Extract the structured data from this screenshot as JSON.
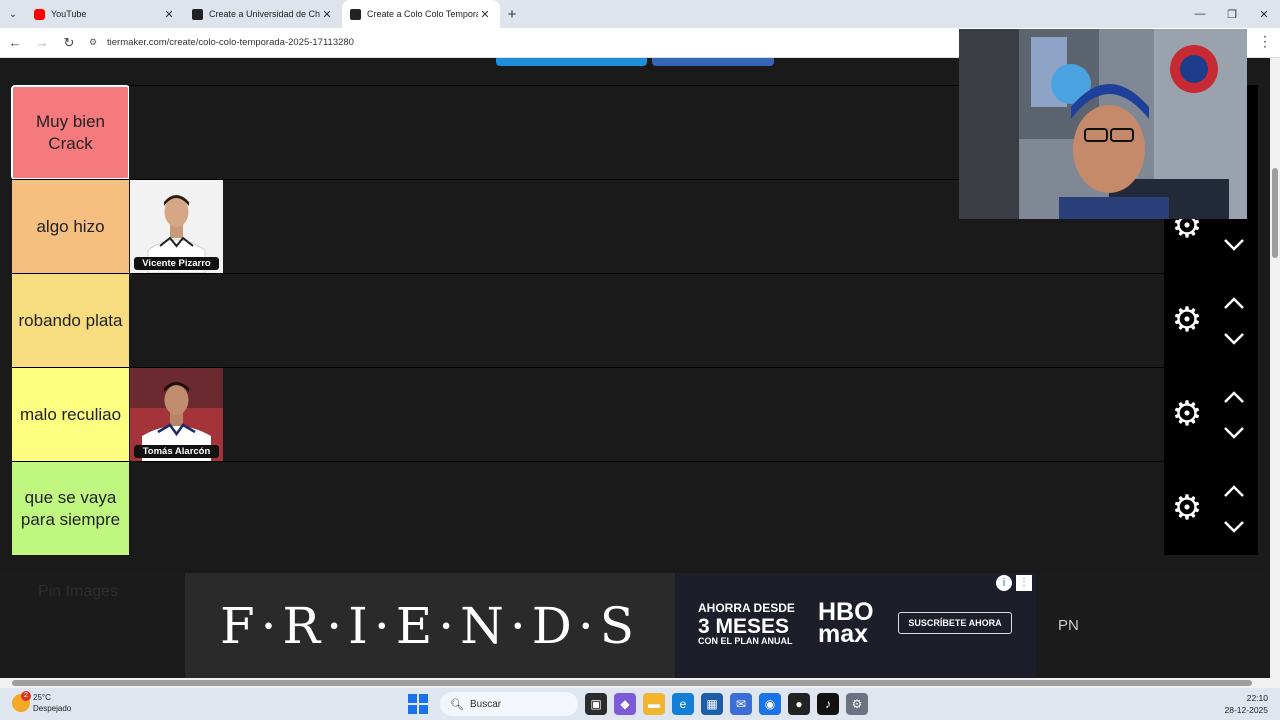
{
  "browser": {
    "tabs": [
      {
        "title": "YouTube",
        "favicon": "youtube-icon",
        "active": false
      },
      {
        "title": "Create a Universidad de Chile Te",
        "favicon": "tiermaker-icon",
        "active": false
      },
      {
        "title": "Create a Colo Colo Temporada",
        "favicon": "tiermaker-icon",
        "active": true
      }
    ],
    "url": "tiermaker.com/create/colo-colo-temporada-2025-17113280"
  },
  "tiers": [
    {
      "label": "Muy bien Crack",
      "color": "#f47a7e",
      "selected": true,
      "items": []
    },
    {
      "label": "algo hizo",
      "color": "#f5bf80",
      "selected": false,
      "items": [
        {
          "name": "Vicente Pizarro"
        }
      ]
    },
    {
      "label": "robando plata",
      "color": "#f7dc80",
      "selected": false,
      "items": []
    },
    {
      "label": "malo reculiao",
      "color": "#fdfd80",
      "selected": false,
      "items": [
        {
          "name": "Tomás Alarcón"
        }
      ]
    },
    {
      "label": "que se vaya para siempre",
      "color": "#bff780",
      "selected": false,
      "items": []
    }
  ],
  "ads": {
    "pin_text": "Pin Images",
    "friends_text": "F·R·I·E·N·D·S",
    "hbo_line1": "AHORRA DESDE",
    "hbo_line2": "3 MESES",
    "hbo_line3": "CON EL PLAN ANUAL",
    "hbo_logo_top": "HBO",
    "hbo_logo_bottom": "max",
    "hbo_cta": "SUSCRÍBETE AHORA",
    "side_text": "PN"
  },
  "taskbar": {
    "weather_temp": "25°C",
    "weather_desc": "Despejado",
    "weather_badge": "2",
    "search_placeholder": "Buscar",
    "time": "22:10",
    "date": "28-12-2025"
  }
}
